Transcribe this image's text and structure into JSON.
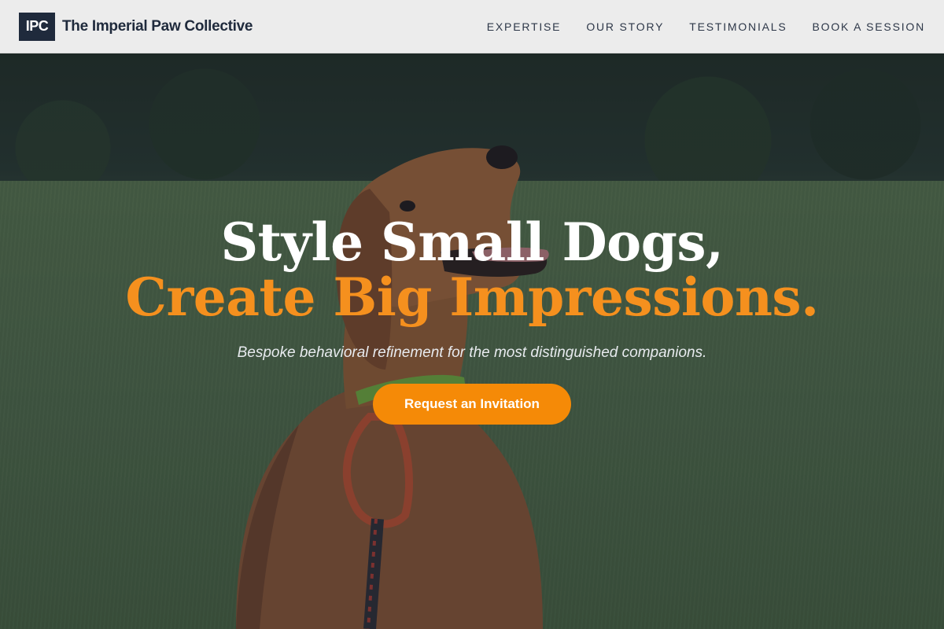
{
  "header": {
    "logo_text": "IPC",
    "brand_name": "The Imperial Paw Collective",
    "nav": [
      {
        "label": "EXPERTISE"
      },
      {
        "label": "OUR STORY"
      },
      {
        "label": "TESTIMONIALS"
      },
      {
        "label": "BOOK A SESSION"
      }
    ]
  },
  "hero": {
    "headline_line1": "Style Small Dogs,",
    "headline_line2": "Create Big Impressions.",
    "tagline": "Bespoke behavioral refinement for the most distinguished companions.",
    "cta_label": "Request an Invitation",
    "background_image": "dog-photo"
  },
  "colors": {
    "accent": "#f58a07",
    "navy": "#1f2a3c",
    "header_bg": "#ececec"
  }
}
